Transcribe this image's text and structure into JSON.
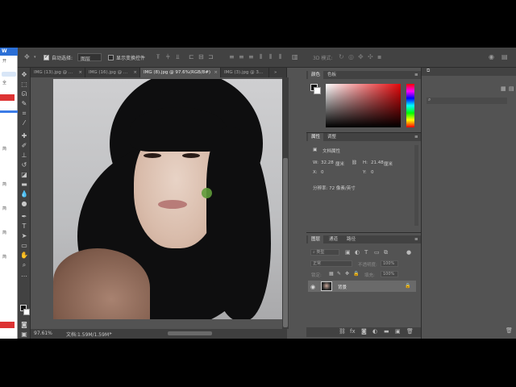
{
  "browser_strip": {
    "tab": "W",
    "lines": [
      "开",
      "全",
      "简",
      "简",
      "简",
      "简",
      "简"
    ]
  },
  "options_bar": {
    "auto_select_label": "自动选择:",
    "auto_select_value": "图层",
    "show_transform_label": "显示变换控件",
    "mode_3d_label": "3D 模式:"
  },
  "tabs": [
    {
      "label": "IMG (13).jpg @ ...",
      "active": false
    },
    {
      "label": "IMG (16).jpg @ ...",
      "active": false
    },
    {
      "label": "IMG (8).jpg @ 97.6%(RGB/8#)",
      "active": true
    },
    {
      "label": "IMG (3).jpg @ 3...",
      "active": false
    }
  ],
  "status": {
    "zoom": "97.61%",
    "doc": "文档:1.59M/1.59M"
  },
  "color_panel": {
    "tab1": "颜色",
    "tab2": "色板"
  },
  "properties_panel": {
    "tab1": "属性",
    "tab2": "调整",
    "section": "文档属性",
    "w_label": "W:",
    "w_value": "32.28",
    "w_unit": "厘米",
    "h_label": "H:",
    "h_value": "21.48",
    "h_unit": "厘米",
    "x_label": "X:",
    "x_value": "0",
    "y_label": "Y:",
    "y_value": "0",
    "resolution": "分辨率: 72 像素/英寸"
  },
  "layers_panel": {
    "tab1": "图层",
    "tab2": "通道",
    "tab3": "路径",
    "filter_kind": "类型",
    "blend_mode": "正常",
    "opacity_label": "不透明度:",
    "opacity_value": "100%",
    "lock_label": "锁定:",
    "fill_label": "填充:",
    "fill_value": "100%",
    "layer_name": "背景"
  },
  "colors": {
    "ps_dark": "#424242",
    "ps_mid": "#535353",
    "accent_blue": "#2b6fd6"
  }
}
